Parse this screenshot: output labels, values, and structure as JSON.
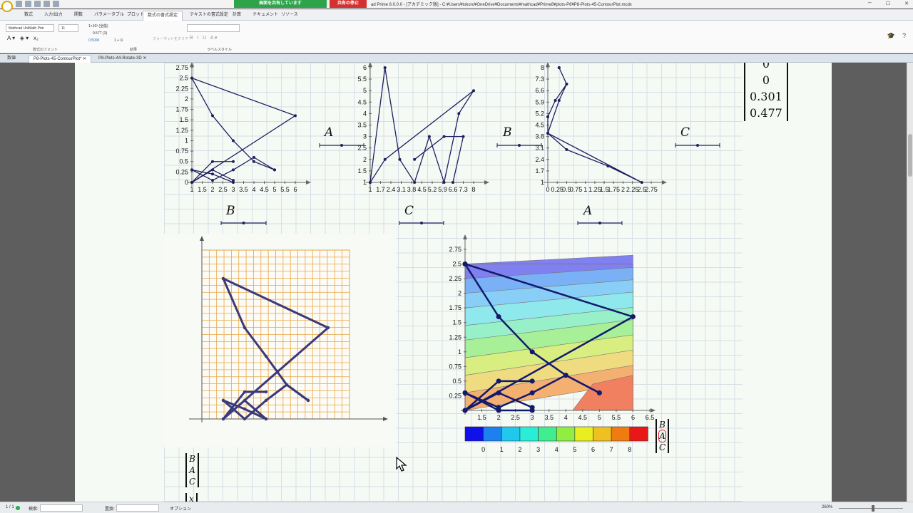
{
  "window": {
    "title": "ad Prime 8.0.0.0 - [アカデミック版] - C:¥Users¥tokoro¥OneDrive¥Documents¥mathcad¥Prime8¥plots-P8¥P8-Plots-45-ContourPlot.mcdx",
    "share_status": "画面を共有しています",
    "stop_share": "共有の停止"
  },
  "ribbon_tabs": [
    "数式",
    "入力/出力",
    "関数",
    "パラメータブル",
    "プロット",
    "数式の書式設定",
    "テキストの書式設定",
    "計算",
    "ドキュメント",
    "リソース"
  ],
  "ribbon_tab_active": "数式の書式設定",
  "ribbon": {
    "font_name": "Mathcad UniMath Prin",
    "font_size": "11",
    "number_format_1": "1×10³ (全般)",
    "number_format_2": "0.57T (3)",
    "number_format_3": "0.5000",
    "number_format_4": "1 + i1",
    "clear_format": "フォーマットをクリア",
    "group_font": "数式のフォント",
    "group_result": "結果",
    "group_label": "ラベルスタイル"
  },
  "doc_tabs": [
    "数値",
    "P8-Plots-45-ContourPlot*",
    "P8-Plots-44-Rotate-3D"
  ],
  "doc_tab_active": 1,
  "status": {
    "page": "1 / 1",
    "search_label": "検索:",
    "replace_label": "置換:",
    "options": "オプション",
    "zoom": "260%"
  },
  "math": {
    "label_a": "A",
    "label_b": "B",
    "label_c": "C",
    "label_x": "x",
    "vector_top": [
      "0",
      "0",
      "0.301",
      "0.477"
    ],
    "vector_bac": [
      "B",
      "A",
      "C"
    ]
  },
  "plots": {
    "p1": {
      "y_ticks": [
        "0",
        "0.25",
        "0.5",
        "0.75",
        "1",
        "1.25",
        "1.5",
        "1.75",
        "2",
        "2.25",
        "2.5",
        "2.75"
      ],
      "x_ticks": [
        "1",
        "1.5",
        "2",
        "2.5",
        "3",
        "3.5",
        "4",
        "4.5",
        "5",
        "5.5",
        "6"
      ]
    },
    "p2": {
      "y_ticks": [
        "1",
        "1.5",
        "2",
        "2.5",
        "3",
        "3.5",
        "4",
        "4.5",
        "5",
        "5.5",
        "6"
      ],
      "x_ticks": [
        "1",
        "1.7",
        "2.4",
        "3.1",
        "3.8",
        "4.5",
        "5.2",
        "5.9",
        "6.6",
        "7.3",
        "8"
      ]
    },
    "p3": {
      "y_ticks": [
        "1",
        "1.7",
        "2.4",
        "3.1",
        "3.8",
        "4.5",
        "5.2",
        "5.9",
        "6.6",
        "7.3",
        "8"
      ],
      "x_ticks": [
        "0",
        "0.25",
        "0.5",
        "0.75",
        "1",
        "1.25",
        "1.5",
        "1.75",
        "2",
        "2.25",
        "2.5",
        "2.75"
      ]
    },
    "contour": {
      "y_ticks": [
        "0.25",
        "0.5",
        "0.75",
        "1",
        "1.25",
        "1.5",
        "1.75",
        "2",
        "2.25",
        "2.5",
        "2.75"
      ],
      "x_ticks": [
        "1.5",
        "2",
        "2.5",
        "3",
        "3.5",
        "4",
        "4.5",
        "5",
        "5.5",
        "6",
        "6.5"
      ],
      "legend_ticks": [
        "0",
        "1",
        "2",
        "3",
        "4",
        "5",
        "6",
        "7",
        "8"
      ],
      "legend_colors": [
        "#1010e8",
        "#1c80ee",
        "#20c8ee",
        "#28eed8",
        "#40ee90",
        "#90ee40",
        "#e8ee20",
        "#eec020",
        "#ee7c10",
        "#e81818"
      ]
    }
  }
}
